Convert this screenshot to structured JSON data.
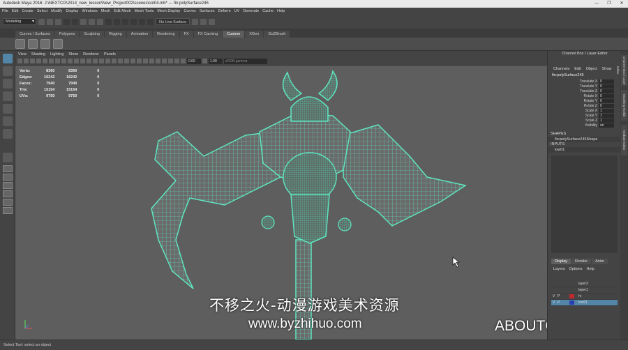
{
  "window": {
    "title": "Autodesk Maya 2016: J:\\NEXTCG\\2014_new_lesson\\New_Project002\\scenes\\col04.mb*  ---  fin:polySurface245",
    "controls": [
      "—",
      "❐",
      "✕"
    ]
  },
  "menubar": [
    "File",
    "Edit",
    "Create",
    "Select",
    "Modify",
    "Display",
    "Windows",
    "Mesh",
    "Edit Mesh",
    "Mesh Tools",
    "Mesh Display",
    "Curves",
    "Surfaces",
    "Deform",
    "UV",
    "Generate",
    "Cache",
    "Help"
  ],
  "statusline": {
    "mode": "Modeling",
    "live_surface": "No Live Surface"
  },
  "shelf_tabs": [
    {
      "label": "Curves / Surfaces",
      "active": false
    },
    {
      "label": "Polygons",
      "active": false
    },
    {
      "label": "Sculpting",
      "active": false
    },
    {
      "label": "Rigging",
      "active": false
    },
    {
      "label": "Animation",
      "active": false
    },
    {
      "label": "Rendering",
      "active": false
    },
    {
      "label": "FX",
      "active": false
    },
    {
      "label": "FX Caching",
      "active": false
    },
    {
      "label": "Custom",
      "active": true
    },
    {
      "label": "XGen",
      "active": false
    },
    {
      "label": "GoZBrush",
      "active": false
    }
  ],
  "viewport_menu": [
    "View",
    "Shading",
    "Lighting",
    "Show",
    "Renderer",
    "Panels"
  ],
  "panel_toolbar": {
    "near_value": "0.00",
    "far_value": "1.00",
    "color_space": "sRGB gamma"
  },
  "hud": [
    {
      "label": "Verts:",
      "a": "8360",
      "b": "8360",
      "c": "0"
    },
    {
      "label": "Edges:",
      "a": "16242",
      "b": "16242",
      "c": "0"
    },
    {
      "label": "Faces:",
      "a": "7940",
      "b": "7940",
      "c": "0"
    },
    {
      "label": "Tris:",
      "a": "15154",
      "b": "15154",
      "c": "0"
    },
    {
      "label": "UVs:",
      "a": "9750",
      "b": "9750",
      "c": "0"
    }
  ],
  "channel_box": {
    "title": "Channel Box / Layer Editor",
    "menu": [
      "Channels",
      "Edit",
      "Object",
      "Show"
    ],
    "object": "fin:polySurface245",
    "attributes": [
      {
        "label": "Translate X",
        "value": "0"
      },
      {
        "label": "Translate Y",
        "value": "0"
      },
      {
        "label": "Translate Z",
        "value": "0"
      },
      {
        "label": "Rotate X",
        "value": "0"
      },
      {
        "label": "Rotate Y",
        "value": "0"
      },
      {
        "label": "Rotate Z",
        "value": "0"
      },
      {
        "label": "Scale X",
        "value": "1"
      },
      {
        "label": "Scale Y",
        "value": "1"
      },
      {
        "label": "Scale Z",
        "value": "1"
      },
      {
        "label": "Visibility",
        "value": "on"
      }
    ],
    "shapes_header": "SHAPES",
    "shape": "fin:polySurface245Shape",
    "inputs_header": "INPUTS",
    "input": "low01"
  },
  "layer_editor": {
    "tabs": [
      {
        "label": "Display",
        "active": true
      },
      {
        "label": "Render",
        "active": false
      },
      {
        "label": "Anim",
        "active": false
      }
    ],
    "menu": [
      "Layers",
      "Options",
      "Help"
    ],
    "layers": [
      {
        "v": "",
        "p": "",
        "color": "#444444",
        "name": "layer3",
        "selected": false
      },
      {
        "v": "",
        "p": "",
        "color": "#444444",
        "name": "layer1",
        "selected": false
      },
      {
        "v": "V",
        "p": "P",
        "color": "#c0282d",
        "name": "hi",
        "selected": false
      },
      {
        "v": "V",
        "p": "P",
        "color": "#2a3fb0",
        "name": "low01",
        "selected": true
      }
    ]
  },
  "side_tabs": [
    "Channel Box / Layer Editor",
    "Modeling Toolkit",
    "Attribute Editor"
  ],
  "help_line": "Select Tool: select an object",
  "watermarks": {
    "chinese": "不移之火-动漫游戏美术资源",
    "url": "www.byzhihuo.com",
    "brand": "ABOUTCG.ORG"
  }
}
